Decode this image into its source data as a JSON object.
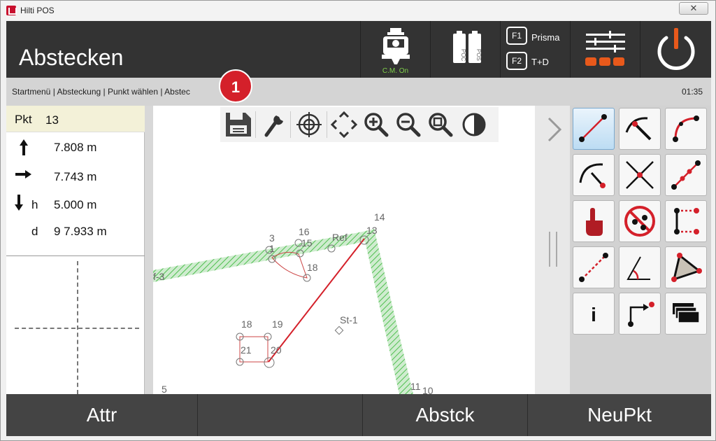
{
  "window": {
    "title": "Hilti POS",
    "close_symbol": "✕"
  },
  "header": {
    "title": "Abstecken",
    "cm_label": "C.M. On",
    "pos_left": "POC",
    "pos_right": "POS",
    "f1_key": "F1",
    "f1_label": "Prisma",
    "f2_key": "F2",
    "f2_label": "T+D"
  },
  "breadcrumb": {
    "text": "Startmenü | Absteckung | Punkt wählen | Abstec",
    "time": "01:35"
  },
  "badge": "1",
  "point": {
    "pkt_label": "Pkt",
    "pkt_value": "13",
    "north_value": "7.808 m",
    "east_value": "7.743 m",
    "h_label": "h",
    "h_value": "5.000 m",
    "d_label": "d",
    "d_value": "9 7.933 m"
  },
  "map": {
    "labels": [
      "14",
      "13",
      "Ref",
      "3",
      "1",
      "16",
      "15",
      "18",
      "f-3",
      "18",
      "19",
      "21",
      "20",
      "St-1",
      "5",
      "11",
      "10"
    ]
  },
  "bottom": {
    "btn1": "Attr",
    "btn2": "",
    "btn3": "Abstck",
    "btn4": "NeuPkt"
  },
  "tools": {
    "info_glyph": "i"
  },
  "colors": {
    "accent_red": "#d4202a",
    "cm_green": "#7fd14a",
    "header_bg": "#333333"
  }
}
